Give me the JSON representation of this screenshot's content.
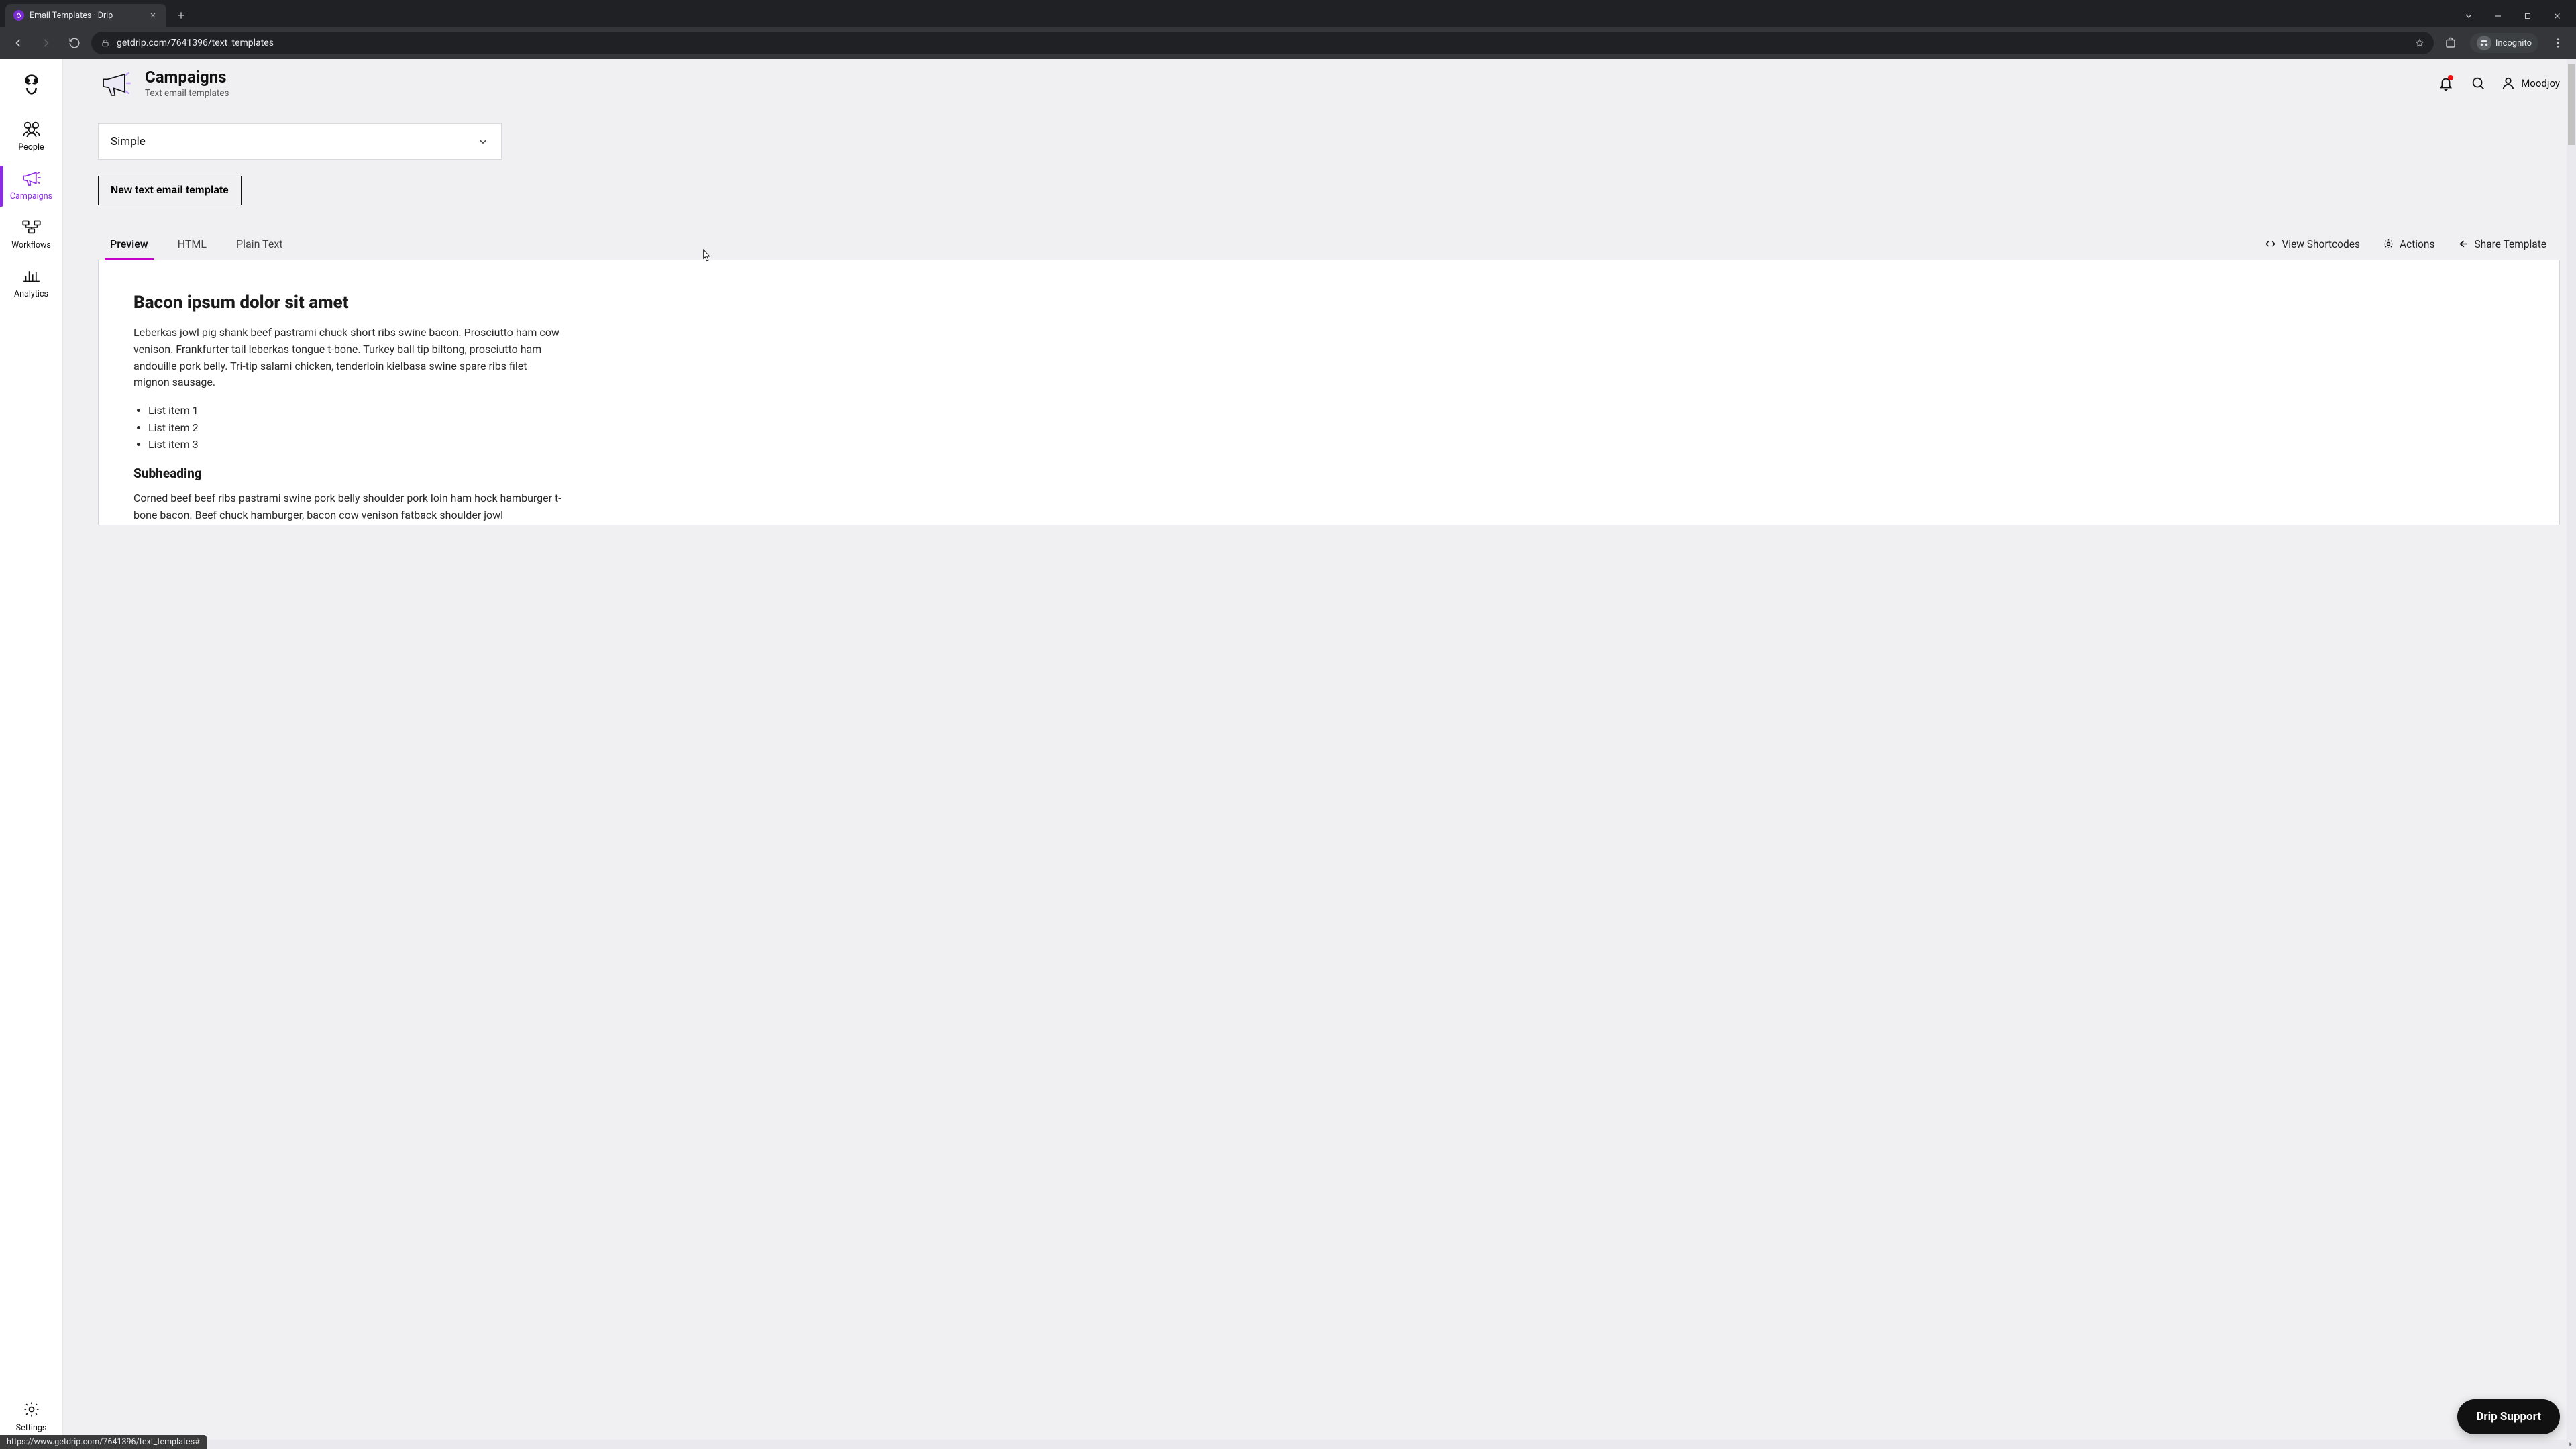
{
  "browser": {
    "tab_title": "Email Templates · Drip",
    "url": "getdrip.com/7641396/text_templates",
    "incognito_label": "Incognito",
    "status_url": "https://www.getdrip.com/7641396/text_templates#"
  },
  "header": {
    "title": "Campaigns",
    "subtitle": "Text email templates",
    "user_label": "Moodjoy"
  },
  "sidebar": {
    "items": [
      {
        "label": "People"
      },
      {
        "label": "Campaigns"
      },
      {
        "label": "Workflows"
      },
      {
        "label": "Analytics"
      }
    ],
    "settings_label": "Settings"
  },
  "controls": {
    "template_select_value": "Simple",
    "new_template_button": "New text email template"
  },
  "tabs": {
    "items": [
      "Preview",
      "HTML",
      "Plain Text"
    ],
    "active_index": 0,
    "actions": {
      "view_shortcodes": "View Shortcodes",
      "actions": "Actions",
      "share": "Share Template"
    }
  },
  "preview": {
    "heading": "Bacon ipsum dolor sit amet",
    "paragraph1": "Leberkas jowl pig shank beef pastrami chuck short ribs swine bacon. Prosciutto ham cow venison. Frankfurter tail leberkas tongue t-bone. Turkey ball tip biltong, prosciutto ham andouille pork belly. Tri-tip salami chicken, tenderloin kielbasa swine spare ribs filet mignon sausage.",
    "list": [
      "List item 1",
      "List item 2",
      "List item 3"
    ],
    "subheading": "Subheading",
    "paragraph2": "Corned beef beef ribs pastrami swine pork belly shoulder pork loin ham hock hamburger t-bone bacon. Beef chuck hamburger, bacon cow venison fatback shoulder jowl"
  },
  "support_button": "Drip Support",
  "colors": {
    "accent_purple": "#8a2be2",
    "tab_underline": "#c400c9"
  }
}
